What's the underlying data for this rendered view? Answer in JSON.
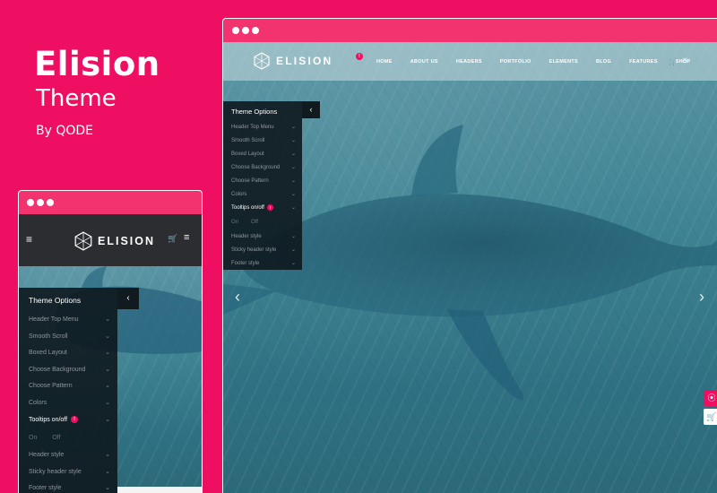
{
  "brand": {
    "title": "Elision",
    "subtitle": "Theme",
    "by": "By QODE",
    "accent_color": "#ee0f62"
  },
  "large_window": {
    "logo_text": "ELISION",
    "nav": [
      "HOME",
      "ABOUT US",
      "HEADERS",
      "PORTFOLIO",
      "ELEMENTS",
      "BLOG",
      "FEATURES",
      "SHOP"
    ],
    "nav_badge": "!",
    "icons": [
      "cart-icon",
      "menu-icon",
      "arrow-left-icon",
      "arrow-right-icon",
      "lifebuoy-icon",
      "cart-icon"
    ]
  },
  "small_window": {
    "logo_text": "ELISION",
    "icons": [
      "hamburger-icon",
      "cart-icon",
      "menu-icon"
    ]
  },
  "theme_options": {
    "title": "Theme Options",
    "items_before": [
      "Header Top Menu",
      "Smooth Scroll",
      "Boxed Layout",
      "Choose Background",
      "Choose Pattern",
      "Colors"
    ],
    "active_item": "Tooltips on/off",
    "badge": "!",
    "on_label": "On",
    "off_label": "Off",
    "items_after": [
      "Header style",
      "Sticky header style",
      "Footer style"
    ]
  }
}
